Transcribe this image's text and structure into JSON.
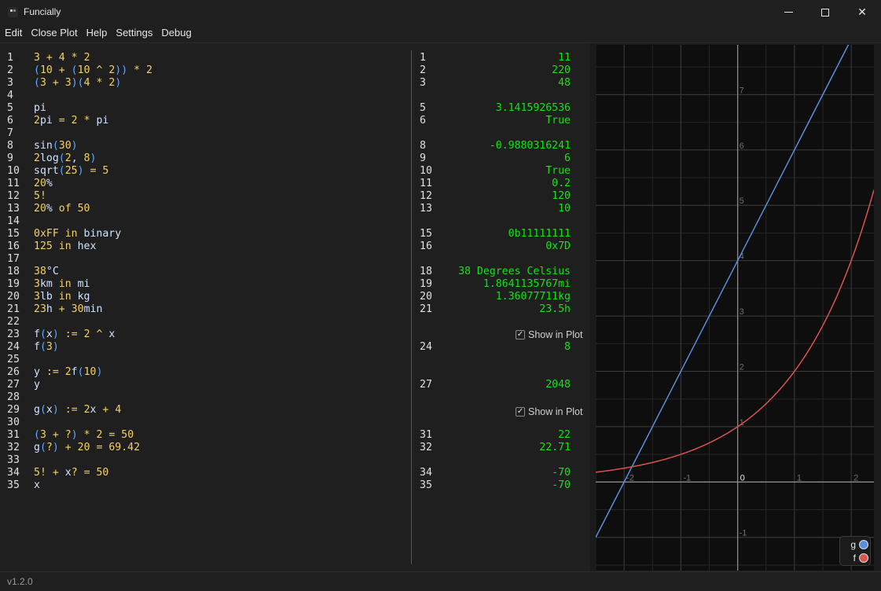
{
  "window": {
    "title": "Funcially",
    "controls": [
      "minimize",
      "maximize",
      "close"
    ]
  },
  "menu": {
    "edit": "Edit",
    "close_plot": "Close Plot",
    "help": "Help",
    "settings": "Settings",
    "debug": "Debug"
  },
  "editor": {
    "line_numbers": [
      "1",
      "2",
      "3",
      "4",
      "5",
      "6",
      "7",
      "8",
      "9",
      "10",
      "11",
      "12",
      "13",
      "14",
      "15",
      "16",
      "17",
      "18",
      "19",
      "20",
      "21",
      "22",
      "23",
      "24",
      "25",
      "26",
      "27",
      "28",
      "29",
      "30",
      "31",
      "32",
      "33",
      "34",
      "35"
    ],
    "lines": [
      [
        [
          "n",
          "3"
        ],
        [
          "o",
          " + "
        ],
        [
          "n",
          "4"
        ],
        [
          "o",
          " * "
        ],
        [
          "n",
          "2"
        ]
      ],
      [
        [
          "p",
          "("
        ],
        [
          "n",
          "10"
        ],
        [
          "o",
          " + "
        ],
        [
          "p",
          "("
        ],
        [
          "n",
          "10"
        ],
        [
          "o",
          " ^ "
        ],
        [
          "n",
          "2"
        ],
        [
          "p",
          "))"
        ],
        [
          "o",
          " * "
        ],
        [
          "n",
          "2"
        ]
      ],
      [
        [
          "p",
          "("
        ],
        [
          "n",
          "3"
        ],
        [
          "o",
          " + "
        ],
        [
          "n",
          "3"
        ],
        [
          "p",
          ")("
        ],
        [
          "n",
          "4"
        ],
        [
          "o",
          " * "
        ],
        [
          "n",
          "2"
        ],
        [
          "p",
          ")"
        ]
      ],
      [],
      [
        [
          "id",
          "pi"
        ]
      ],
      [
        [
          "n",
          "2"
        ],
        [
          "id",
          "pi"
        ],
        [
          "o",
          " = "
        ],
        [
          "n",
          "2"
        ],
        [
          "o",
          " * "
        ],
        [
          "id",
          "pi"
        ]
      ],
      [],
      [
        [
          "id",
          "sin"
        ],
        [
          "p",
          "("
        ],
        [
          "n",
          "30"
        ],
        [
          "p",
          ")"
        ]
      ],
      [
        [
          "n",
          "2"
        ],
        [
          "id",
          "log"
        ],
        [
          "p",
          "("
        ],
        [
          "n",
          "2"
        ],
        [
          "id",
          ", "
        ],
        [
          "n",
          "8"
        ],
        [
          "p",
          ")"
        ]
      ],
      [
        [
          "id",
          "sqrt"
        ],
        [
          "p",
          "("
        ],
        [
          "n",
          "25"
        ],
        [
          "p",
          ")"
        ],
        [
          "o",
          " = "
        ],
        [
          "n",
          "5"
        ]
      ],
      [
        [
          "n",
          "20"
        ],
        [
          "id",
          "%"
        ]
      ],
      [
        [
          "n",
          "5"
        ],
        [
          "o",
          "!"
        ]
      ],
      [
        [
          "n",
          "20"
        ],
        [
          "id",
          "%"
        ],
        [
          "k",
          " of "
        ],
        [
          "n",
          "50"
        ]
      ],
      [],
      [
        [
          "n",
          "0xFF"
        ],
        [
          "k",
          " in "
        ],
        [
          "id",
          "binary"
        ]
      ],
      [
        [
          "n",
          "125"
        ],
        [
          "k",
          " in "
        ],
        [
          "id",
          "hex"
        ]
      ],
      [],
      [
        [
          "n",
          "38"
        ],
        [
          "id",
          "°C"
        ]
      ],
      [
        [
          "n",
          "3"
        ],
        [
          "id",
          "km"
        ],
        [
          "k",
          " in "
        ],
        [
          "id",
          "mi"
        ]
      ],
      [
        [
          "n",
          "3"
        ],
        [
          "id",
          "lb"
        ],
        [
          "k",
          " in "
        ],
        [
          "id",
          "kg"
        ]
      ],
      [
        [
          "n",
          "23"
        ],
        [
          "id",
          "h"
        ],
        [
          "o",
          " + "
        ],
        [
          "n",
          "30"
        ],
        [
          "id",
          "min"
        ]
      ],
      [],
      [
        [
          "id",
          "f"
        ],
        [
          "p",
          "("
        ],
        [
          "id",
          "x"
        ],
        [
          "p",
          ")"
        ],
        [
          "o",
          " := "
        ],
        [
          "n",
          "2"
        ],
        [
          "o",
          " ^ "
        ],
        [
          "id",
          "x"
        ]
      ],
      [
        [
          "id",
          "f"
        ],
        [
          "p",
          "("
        ],
        [
          "n",
          "3"
        ],
        [
          "p",
          ")"
        ]
      ],
      [],
      [
        [
          "id",
          "y"
        ],
        [
          "o",
          " := "
        ],
        [
          "n",
          "2"
        ],
        [
          "id",
          "f"
        ],
        [
          "p",
          "("
        ],
        [
          "n",
          "10"
        ],
        [
          "p",
          ")"
        ]
      ],
      [
        [
          "id",
          "y"
        ]
      ],
      [],
      [
        [
          "id",
          "g"
        ],
        [
          "p",
          "("
        ],
        [
          "id",
          "x"
        ],
        [
          "p",
          ")"
        ],
        [
          "o",
          " := "
        ],
        [
          "n",
          "2"
        ],
        [
          "id",
          "x"
        ],
        [
          "o",
          " + "
        ],
        [
          "n",
          "4"
        ]
      ],
      [],
      [
        [
          "p",
          "("
        ],
        [
          "n",
          "3"
        ],
        [
          "o",
          " + "
        ],
        [
          "n",
          "?"
        ],
        [
          "p",
          ")"
        ],
        [
          "o",
          " * "
        ],
        [
          "n",
          "2"
        ],
        [
          "o",
          " = "
        ],
        [
          "n",
          "50"
        ]
      ],
      [
        [
          "id",
          "g"
        ],
        [
          "p",
          "("
        ],
        [
          "n",
          "?"
        ],
        [
          "p",
          ")"
        ],
        [
          "o",
          " + "
        ],
        [
          "n",
          "20"
        ],
        [
          "o",
          " = "
        ],
        [
          "n",
          "69.42"
        ]
      ],
      [],
      [
        [
          "n",
          "5"
        ],
        [
          "o",
          "!"
        ],
        [
          "o",
          " + "
        ],
        [
          "id",
          "x"
        ],
        [
          "n",
          "?"
        ],
        [
          "o",
          " = "
        ],
        [
          "n",
          "50"
        ]
      ],
      [
        [
          "id",
          "x"
        ]
      ]
    ]
  },
  "results": {
    "rows": [
      {
        "line": "1",
        "value": "11"
      },
      {
        "line": "2",
        "value": "220"
      },
      {
        "line": "3",
        "value": "48"
      },
      {
        "line": "",
        "value": ""
      },
      {
        "line": "5",
        "value": "3.1415926536"
      },
      {
        "line": "6",
        "value": "True"
      },
      {
        "line": "",
        "value": ""
      },
      {
        "line": "8",
        "value": "-0.9880316241"
      },
      {
        "line": "9",
        "value": "6"
      },
      {
        "line": "10",
        "value": "True"
      },
      {
        "line": "11",
        "value": "0.2"
      },
      {
        "line": "12",
        "value": "120"
      },
      {
        "line": "13",
        "value": "10"
      },
      {
        "line": "",
        "value": ""
      },
      {
        "line": "15",
        "value": "0b11111111"
      },
      {
        "line": "16",
        "value": "0x7D"
      },
      {
        "line": "",
        "value": ""
      },
      {
        "line": "18",
        "value": "38 Degrees Celsius"
      },
      {
        "line": "19",
        "value": "1.8641135767mi"
      },
      {
        "line": "20",
        "value": "1.36077711kg"
      },
      {
        "line": "21",
        "value": "23.5h"
      },
      {
        "line": "",
        "value": ""
      },
      {
        "line": "",
        "value": ""
      },
      {
        "line": "24",
        "value": "8"
      },
      {
        "line": "",
        "value": ""
      },
      {
        "line": "",
        "value": ""
      },
      {
        "line": "27",
        "value": "2048"
      },
      {
        "line": "",
        "value": ""
      },
      {
        "line": "",
        "value": ""
      },
      {
        "line": "",
        "value": ""
      },
      {
        "line": "31",
        "value": "22"
      },
      {
        "line": "32",
        "value": "22.71"
      },
      {
        "line": "",
        "value": ""
      },
      {
        "line": "34",
        "value": "-70"
      },
      {
        "line": "35",
        "value": "-70"
      }
    ],
    "show_in_plot_label": "Show in Plot",
    "show_in_plot_checked": true
  },
  "plot": {
    "x_tick_labels": [
      "-2",
      "-1",
      "0",
      "1",
      "2"
    ],
    "y_tick_labels": [
      "-1",
      "1",
      "2",
      "3",
      "4",
      "5",
      "6",
      "7"
    ],
    "functions": [
      {
        "name": "g",
        "expression": "2x + 4",
        "color": "#5b8fd9"
      },
      {
        "name": "f",
        "expression": "2 ^ x",
        "color": "#d9534f"
      }
    ],
    "xlim": [
      -2.5,
      2.4
    ],
    "ylim": [
      -1.6,
      7.9
    ]
  },
  "status": {
    "version": "v1.2.0"
  },
  "colors": {
    "background": "#1f1f1f",
    "result_green": "#16e016",
    "number_yellow": "#f2d16b",
    "paren_blue": "#5fa8ff"
  }
}
